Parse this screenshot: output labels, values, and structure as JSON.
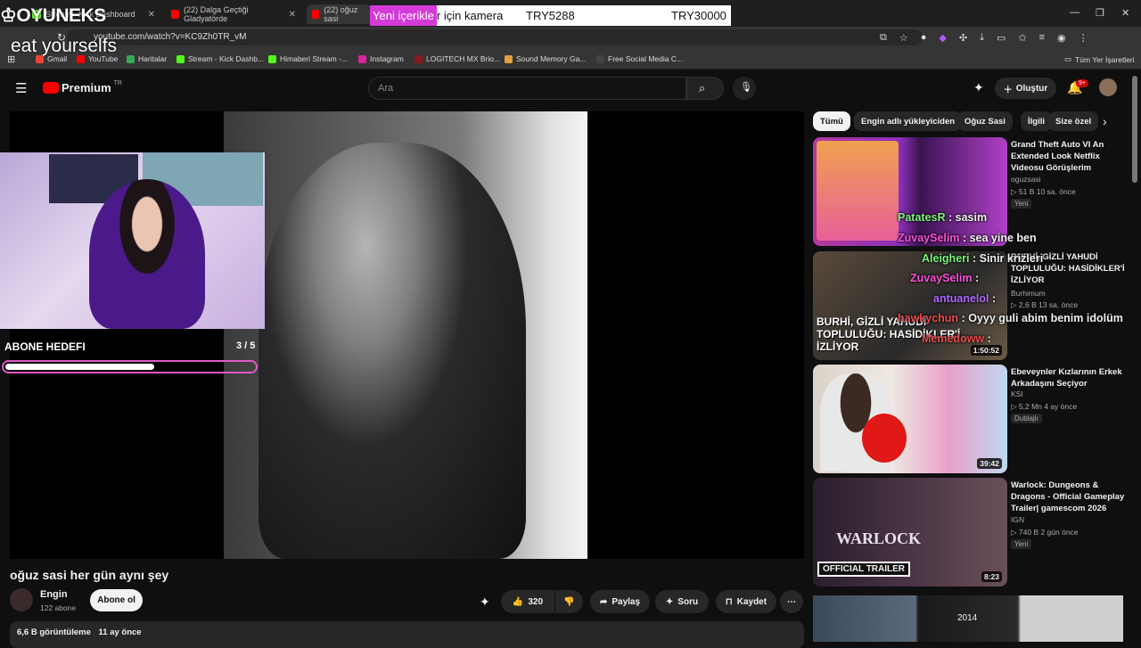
{
  "browser": {
    "tabs": [
      {
        "title": "Stream - Kick Dashboard",
        "color": "#53fc18"
      },
      {
        "title": "(22) Dalga Geçtiği Gladyatörde",
        "color": "#ff0000"
      },
      {
        "title": "(22) oğuz sasi",
        "color": "#ff0000"
      }
    ],
    "promo": {
      "highlight": "Yeni içerikle",
      "rest": "r için kamera",
      "price1": "TRY5288",
      "price2": "TRY30000"
    },
    "url": "youtube.com/watch?v=KC9Zh0TR_vM",
    "bookmarks": [
      "Gmail",
      "YouTube",
      "Haritalar",
      "Stream - Kick Dashb...",
      "Himaberl Stream -...",
      "Instagram",
      "LOGITECH MX Brio...",
      "Sound Memory Ga...",
      "Free Social Media C..."
    ],
    "all_bookmarks": "Tüm Yer İşaretleri"
  },
  "overlay": {
    "logo": "OYUNEKS",
    "eat_text": "eat yourselfs",
    "goal_label": "ABONE HEDEFI",
    "goal_count": "3 / 5",
    "goal_progress": 0.6
  },
  "youtube": {
    "brand": "Premium",
    "region": "TR",
    "search_placeholder": "Ara",
    "create": "Oluştur",
    "notif_count": "9+",
    "chips": [
      "Tümü",
      "Engin adlı yükleyiciden",
      "Oğuz Sasi",
      "İlgili",
      "Size özel"
    ]
  },
  "video": {
    "title": "oğuz sasi her gün aynı şey",
    "channel": "Engin",
    "subs": "122 abone",
    "subscribe": "Abone ol",
    "likes": "320",
    "share": "Paylaş",
    "ask": "Soru",
    "save": "Kaydet",
    "views": "6,6 B görüntüleme",
    "ago": "11 ay önce"
  },
  "recommendations": [
    {
      "title": "Grand Theft Auto VI An Extended Look Netflix Videosu Görüşlerim",
      "channel": "oguzsasi",
      "meta": "▷ 51 B   10 sa. önce",
      "badge": "Yeni",
      "duration": ""
    },
    {
      "title": "BURHİ, GİZLİ YAHUDİ TOPLULUĞU: HASİDİKLER'İ İZLİYOR",
      "channel": "Burhimum",
      "meta": "▷ 2,6 B   13 sa. önce",
      "badge": "",
      "duration": "1:50:52",
      "thumb_text": "BURHİ, GİZLİ YAHUDİ TOPLULUĞU: HASİDİKLER'İ İZLİYOR"
    },
    {
      "title": "Ebeveynler Kızlarının Erkek Arkadaşını Seçiyor",
      "channel": "KSI",
      "meta": "▷ 5,2 Mn   4 ay önce",
      "badge": "Dublajlı",
      "duration": "39:42"
    },
    {
      "title": "Warlock: Dungeons & Dragons - Official Gameplay Trailer| gamescom 2026",
      "channel": "IGN",
      "meta": "▷ 740 B   2 gün önce",
      "badge": "Yeni",
      "duration": "8:23",
      "thumb_text": "WARLOCK",
      "thumb_tag": "OFFICIAL TRAILER"
    }
  ],
  "chat": [
    {
      "user": "PatatesR",
      "msg": ": sasim",
      "color": "#7cf27c"
    },
    {
      "user": "ZuvaySelim",
      "msg": ": sea yine ben",
      "color": "#ff4fd8"
    },
    {
      "user": "Aleigheri",
      "msg": ": Sinir krizleri",
      "color": "#7cf27c"
    },
    {
      "user": "ZuvaySelim",
      "msg": ":",
      "color": "#ff4fd8"
    },
    {
      "user": "antuanelol",
      "msg": ":",
      "color": "#b06cff"
    },
    {
      "user": "hawkychun",
      "msg": ": Oyyy guli abim benim idolüm",
      "color": "#e84d4d"
    },
    {
      "user": "Memedoww",
      "msg": ":",
      "color": "#e84d4d"
    }
  ],
  "bottom_thumb_text": "2014"
}
